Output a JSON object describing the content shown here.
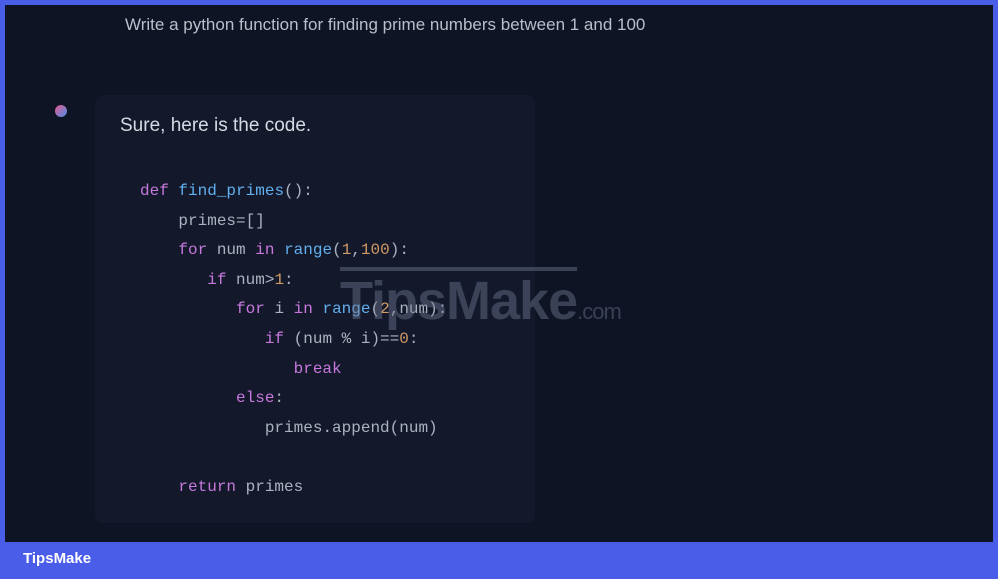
{
  "prompt": "Write a python function for finding prime numbers between 1 and 100",
  "response_intro": "Sure, here is the code.",
  "code": {
    "l1_def": "def",
    "l1_fn": "find_primes",
    "l1_paren": "():",
    "l2": "primes=[]",
    "l3_for": "for",
    "l3_num": "num",
    "l3_in": "in",
    "l3_range": "range",
    "l3_open": "(",
    "l3_a": "1",
    "l3_comma": ",",
    "l3_b": "100",
    "l3_close": "):",
    "l4_if": "if",
    "l4_cond_a": "num>",
    "l4_cond_b": "1",
    "l4_colon": ":",
    "l5_for": "for",
    "l5_i": "i",
    "l5_in": "in",
    "l5_range": "range",
    "l5_open": "(",
    "l5_a": "2",
    "l5_comma": ",",
    "l5_b": "num",
    "l5_close": "):",
    "l6_if": "if",
    "l6_open": "(num % i)==",
    "l6_zero": "0",
    "l6_colon": ":",
    "l7_break": "break",
    "l8_else": "else",
    "l8_colon": ":",
    "l9": "primes.append(num)",
    "l10_return": "return",
    "l10_val": "primes"
  },
  "footer": "TipsMake",
  "watermark_main": "TipsMake",
  "watermark_suffix": ".com"
}
